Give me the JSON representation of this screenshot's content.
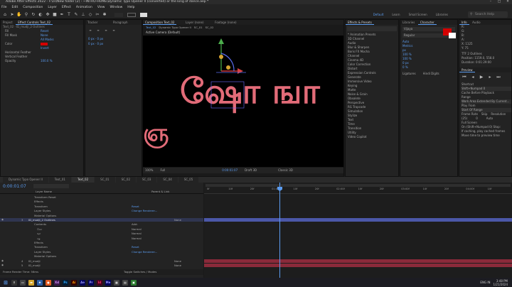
{
  "app": {
    "title": "Adobe After Effects 2022 - F:\\cs\\New folder (2) - ~INTRO-HOME\\Dynamic Typo Opener II (converted) or the king of dance.aep *"
  },
  "menu": [
    "File",
    "Edit",
    "Composition",
    "Layer",
    "Effect",
    "Animation",
    "View",
    "Window",
    "Help"
  ],
  "workspaces": [
    "Default",
    "Learn",
    "Small Screen",
    "Libraries"
  ],
  "search_placeholder": "Search Help",
  "left_panel": {
    "tabs": [
      "Project",
      "Effect Controls Text_02"
    ],
    "header": "Text_02 · ID_mudji_2 Outlines",
    "rows": [
      {
        "label": "Fill",
        "value": "Reset"
      },
      {
        "label": "Fill Mask",
        "value": "None"
      },
      {
        "label": "",
        "value": "All Masks"
      },
      {
        "label": "Color",
        "value": ""
      },
      {
        "label": "",
        "value": "Invert"
      },
      {
        "label": "Horizontal Feather",
        "value": ""
      },
      {
        "label": "Vertical Feather",
        "value": ""
      },
      {
        "label": "Opacity",
        "value": "100.0 %"
      }
    ]
  },
  "small_panels": [
    {
      "tab": "Tracker"
    },
    {
      "tab": "Paragraph"
    }
  ],
  "comp_tabs": [
    "Composition Text_02",
    "Layer (none)",
    "Footage (none)"
  ],
  "comp_sub": [
    "Text_02",
    "Dynamic Typo Opener II",
    "SC_01",
    "SC_02"
  ],
  "viewer": {
    "label": "Active Camera (Default)",
    "text": "ஷோ ஙா"
  },
  "viewer_footer": [
    "100%",
    "Full",
    "0:00:01:07",
    "Draft 3D",
    "Classic 3D"
  ],
  "effects_panel": {
    "title": "Effects & Presets",
    "items": [
      "* Animation Presets",
      "3D Channel",
      "Audio",
      "Blur & Sharpen",
      "Boris FX Mocha",
      "Channel",
      "Cinema 4D",
      "Color Correction",
      "Distort",
      "Expression Controls",
      "Generate",
      "Immersive Video",
      "Keying",
      "Matte",
      "Noise & Grain",
      "Obsolete",
      "Perspective",
      "RG Trapcode",
      "Simulation",
      "Stylize",
      "Text",
      "Time",
      "Transition",
      "Utility",
      "Video Copilot"
    ]
  },
  "character_panel": {
    "tabs": [
      "Libraries",
      "Character",
      "Info",
      "Audio"
    ],
    "font": "Vijaya",
    "style": "Regular",
    "rows": [
      "Auto",
      "Metrics",
      "px",
      "100 %",
      "100 %",
      "0 px",
      "0 %"
    ],
    "checks": [
      "Ligatures",
      "Hindi Digits"
    ],
    "info": [
      "R:",
      "G:",
      "B:",
      "A:",
      "X: 1125",
      "Y: 75"
    ],
    "info_extra": [
      "TTF 2 Outlines",
      "Position: 1159.0, 558.0",
      "Duration: 0:01:29:00"
    ]
  },
  "preview_panel": {
    "title": "Preview",
    "shortcut_label": "Shortcut",
    "shortcut": "Shift+Numpad 0",
    "cache": "Cache Before Playback",
    "range_label": "Range",
    "range": "Work Area Extended By Current...",
    "play_from": "Play From",
    "play_from_val": "Start Of Range",
    "frame_rate": "Frame Rate",
    "skip": "Skip",
    "resolution": "Resolution",
    "fr_val": "(25)",
    "skip_val": "0",
    "res_val": "Auto",
    "full_screen": "Full Screen",
    "on_stop": "On (Shift+Numpad 0) Stop:",
    "if_caching": "If caching, play cached frames",
    "move_time": "Move time to preview time"
  },
  "timeline": {
    "tabs": [
      "Dynamic Typo Opener II",
      "Text_01",
      "Text_02",
      "SC_01",
      "SC_02",
      "SC_03",
      "SC_04",
      "SC_05"
    ],
    "timecode": "0:00:01:07",
    "ruler": [
      "0f",
      "10f",
      "20f",
      "01:00f",
      "10f",
      "20f",
      "02:00f",
      "10f",
      "20f",
      "03:00f",
      "10f",
      "20f",
      "04:00f",
      "10f"
    ],
    "columns": [
      "Layer Name",
      "Parent & Link"
    ],
    "layers": [
      {
        "num": "",
        "name": "Transform  Reset",
        "indent": 2,
        "mode": "",
        "sel": false
      },
      {
        "num": "",
        "name": "Effects",
        "indent": 2,
        "mode": "",
        "sel": false
      },
      {
        "num": "",
        "name": "Transform",
        "indent": 2,
        "mode": "Reset",
        "sel": false
      },
      {
        "num": "",
        "name": "Layer Styles",
        "indent": 2,
        "mode": "Change Renderer...",
        "sel": false
      },
      {
        "num": "",
        "name": "Material Options",
        "indent": 2,
        "mode": "",
        "sel": false
      },
      {
        "num": "3",
        "name": "ID_mudji_2 Outlines",
        "indent": 0,
        "mode": "None",
        "sel": true
      },
      {
        "num": "",
        "name": "Contents",
        "indent": 2,
        "mode": "Add:",
        "sel": false
      },
      {
        "num": "",
        "name": "கோ",
        "indent": 3,
        "mode": "Normal",
        "sel": false
      },
      {
        "num": "",
        "name": "ஙா",
        "indent": 3,
        "mode": "Normal",
        "sel": false
      },
      {
        "num": "",
        "name": "ஷ",
        "indent": 3,
        "mode": "Normal",
        "sel": false
      },
      {
        "num": "",
        "name": "Effects",
        "indent": 2,
        "mode": "",
        "sel": false
      },
      {
        "num": "",
        "name": "Transform",
        "indent": 2,
        "mode": "Reset",
        "sel": false
      },
      {
        "num": "",
        "name": "Layer Styles",
        "indent": 2,
        "mode": "Change Renderer...",
        "sel": false
      },
      {
        "num": "",
        "name": "Material Options",
        "indent": 2,
        "mode": "",
        "sel": false
      },
      {
        "num": "4",
        "name": "ID_mudji",
        "indent": 0,
        "mode": "None",
        "sel": false,
        "red": true
      },
      {
        "num": "5",
        "name": "ID_mudji",
        "indent": 0,
        "mode": "None",
        "sel": false,
        "red": true
      }
    ],
    "footer_left": "Frame Render Time: 56ms",
    "footer_mid": "Toggle Switches / Modes"
  },
  "taskbar": {
    "time": "3:48 PM",
    "date": "1/21/2024",
    "lang": "ENG IN"
  }
}
